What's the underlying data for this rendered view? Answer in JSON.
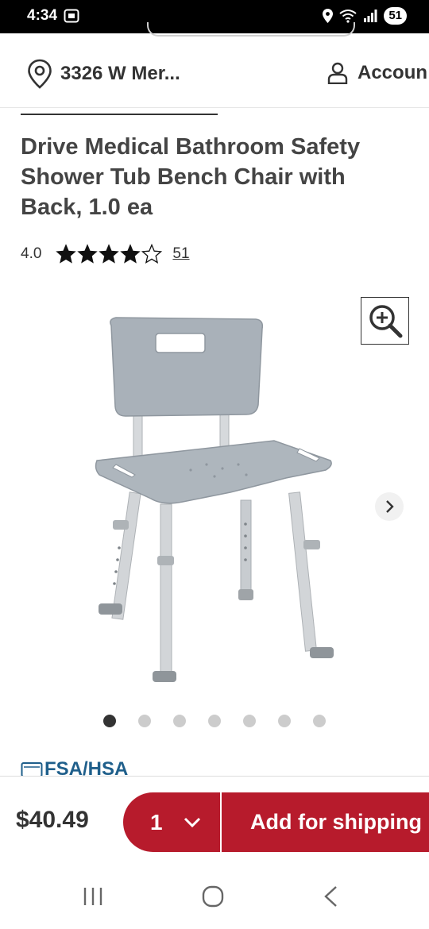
{
  "status_bar": {
    "time": "4:34",
    "battery": "51",
    "icons": [
      "screenshot-icon",
      "location-icon",
      "wifi-icon",
      "signal-icon",
      "battery-icon"
    ]
  },
  "header": {
    "location_text": "3326 W Mer...",
    "account_text": "Accoun",
    "icons": [
      "location-pin-icon",
      "user-icon"
    ]
  },
  "product": {
    "title": "Drive Medical Bathroom Safety Shower Tub Bench Chair with Back, 1.0 ea",
    "rating_value": "4.0",
    "rating": 4.0,
    "rating_max": 5,
    "review_count": "51",
    "image_count": 7,
    "active_image": 1,
    "fsa_label": "FSA/HSA"
  },
  "purchase_bar": {
    "price": "$40.49",
    "quantity": "1",
    "add_label": "Add for shipping"
  },
  "colors": {
    "accent": "#b71b2c",
    "fsa": "#1f5f8b",
    "text": "#333333",
    "dot_inactive": "#cccccc"
  },
  "nav_bar": {
    "icons": [
      "recent-apps-icon",
      "home-icon",
      "back-icon"
    ]
  }
}
